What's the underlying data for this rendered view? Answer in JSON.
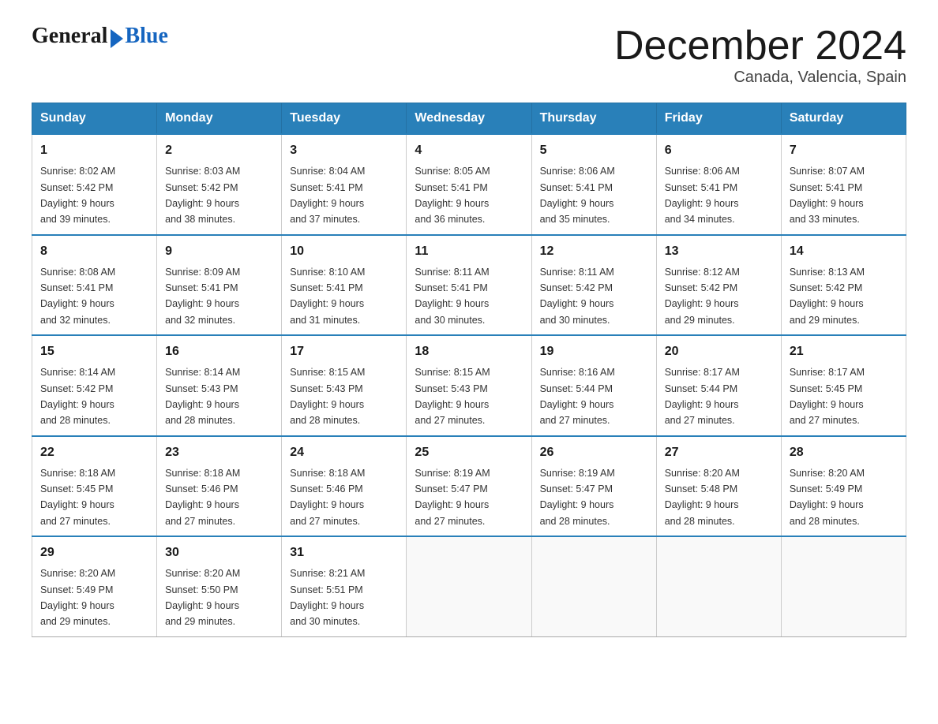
{
  "logo": {
    "text_general": "General",
    "text_blue": "Blue",
    "arrow": true
  },
  "title": "December 2024",
  "subtitle": "Canada, Valencia, Spain",
  "days_of_week": [
    "Sunday",
    "Monday",
    "Tuesday",
    "Wednesday",
    "Thursday",
    "Friday",
    "Saturday"
  ],
  "weeks": [
    [
      {
        "day": "1",
        "sunrise": "Sunrise: 8:02 AM",
        "sunset": "Sunset: 5:42 PM",
        "daylight": "Daylight: 9 hours",
        "daylight2": "and 39 minutes."
      },
      {
        "day": "2",
        "sunrise": "Sunrise: 8:03 AM",
        "sunset": "Sunset: 5:42 PM",
        "daylight": "Daylight: 9 hours",
        "daylight2": "and 38 minutes."
      },
      {
        "day": "3",
        "sunrise": "Sunrise: 8:04 AM",
        "sunset": "Sunset: 5:41 PM",
        "daylight": "Daylight: 9 hours",
        "daylight2": "and 37 minutes."
      },
      {
        "day": "4",
        "sunrise": "Sunrise: 8:05 AM",
        "sunset": "Sunset: 5:41 PM",
        "daylight": "Daylight: 9 hours",
        "daylight2": "and 36 minutes."
      },
      {
        "day": "5",
        "sunrise": "Sunrise: 8:06 AM",
        "sunset": "Sunset: 5:41 PM",
        "daylight": "Daylight: 9 hours",
        "daylight2": "and 35 minutes."
      },
      {
        "day": "6",
        "sunrise": "Sunrise: 8:06 AM",
        "sunset": "Sunset: 5:41 PM",
        "daylight": "Daylight: 9 hours",
        "daylight2": "and 34 minutes."
      },
      {
        "day": "7",
        "sunrise": "Sunrise: 8:07 AM",
        "sunset": "Sunset: 5:41 PM",
        "daylight": "Daylight: 9 hours",
        "daylight2": "and 33 minutes."
      }
    ],
    [
      {
        "day": "8",
        "sunrise": "Sunrise: 8:08 AM",
        "sunset": "Sunset: 5:41 PM",
        "daylight": "Daylight: 9 hours",
        "daylight2": "and 32 minutes."
      },
      {
        "day": "9",
        "sunrise": "Sunrise: 8:09 AM",
        "sunset": "Sunset: 5:41 PM",
        "daylight": "Daylight: 9 hours",
        "daylight2": "and 32 minutes."
      },
      {
        "day": "10",
        "sunrise": "Sunrise: 8:10 AM",
        "sunset": "Sunset: 5:41 PM",
        "daylight": "Daylight: 9 hours",
        "daylight2": "and 31 minutes."
      },
      {
        "day": "11",
        "sunrise": "Sunrise: 8:11 AM",
        "sunset": "Sunset: 5:41 PM",
        "daylight": "Daylight: 9 hours",
        "daylight2": "and 30 minutes."
      },
      {
        "day": "12",
        "sunrise": "Sunrise: 8:11 AM",
        "sunset": "Sunset: 5:42 PM",
        "daylight": "Daylight: 9 hours",
        "daylight2": "and 30 minutes."
      },
      {
        "day": "13",
        "sunrise": "Sunrise: 8:12 AM",
        "sunset": "Sunset: 5:42 PM",
        "daylight": "Daylight: 9 hours",
        "daylight2": "and 29 minutes."
      },
      {
        "day": "14",
        "sunrise": "Sunrise: 8:13 AM",
        "sunset": "Sunset: 5:42 PM",
        "daylight": "Daylight: 9 hours",
        "daylight2": "and 29 minutes."
      }
    ],
    [
      {
        "day": "15",
        "sunrise": "Sunrise: 8:14 AM",
        "sunset": "Sunset: 5:42 PM",
        "daylight": "Daylight: 9 hours",
        "daylight2": "and 28 minutes."
      },
      {
        "day": "16",
        "sunrise": "Sunrise: 8:14 AM",
        "sunset": "Sunset: 5:43 PM",
        "daylight": "Daylight: 9 hours",
        "daylight2": "and 28 minutes."
      },
      {
        "day": "17",
        "sunrise": "Sunrise: 8:15 AM",
        "sunset": "Sunset: 5:43 PM",
        "daylight": "Daylight: 9 hours",
        "daylight2": "and 28 minutes."
      },
      {
        "day": "18",
        "sunrise": "Sunrise: 8:15 AM",
        "sunset": "Sunset: 5:43 PM",
        "daylight": "Daylight: 9 hours",
        "daylight2": "and 27 minutes."
      },
      {
        "day": "19",
        "sunrise": "Sunrise: 8:16 AM",
        "sunset": "Sunset: 5:44 PM",
        "daylight": "Daylight: 9 hours",
        "daylight2": "and 27 minutes."
      },
      {
        "day": "20",
        "sunrise": "Sunrise: 8:17 AM",
        "sunset": "Sunset: 5:44 PM",
        "daylight": "Daylight: 9 hours",
        "daylight2": "and 27 minutes."
      },
      {
        "day": "21",
        "sunrise": "Sunrise: 8:17 AM",
        "sunset": "Sunset: 5:45 PM",
        "daylight": "Daylight: 9 hours",
        "daylight2": "and 27 minutes."
      }
    ],
    [
      {
        "day": "22",
        "sunrise": "Sunrise: 8:18 AM",
        "sunset": "Sunset: 5:45 PM",
        "daylight": "Daylight: 9 hours",
        "daylight2": "and 27 minutes."
      },
      {
        "day": "23",
        "sunrise": "Sunrise: 8:18 AM",
        "sunset": "Sunset: 5:46 PM",
        "daylight": "Daylight: 9 hours",
        "daylight2": "and 27 minutes."
      },
      {
        "day": "24",
        "sunrise": "Sunrise: 8:18 AM",
        "sunset": "Sunset: 5:46 PM",
        "daylight": "Daylight: 9 hours",
        "daylight2": "and 27 minutes."
      },
      {
        "day": "25",
        "sunrise": "Sunrise: 8:19 AM",
        "sunset": "Sunset: 5:47 PM",
        "daylight": "Daylight: 9 hours",
        "daylight2": "and 27 minutes."
      },
      {
        "day": "26",
        "sunrise": "Sunrise: 8:19 AM",
        "sunset": "Sunset: 5:47 PM",
        "daylight": "Daylight: 9 hours",
        "daylight2": "and 28 minutes."
      },
      {
        "day": "27",
        "sunrise": "Sunrise: 8:20 AM",
        "sunset": "Sunset: 5:48 PM",
        "daylight": "Daylight: 9 hours",
        "daylight2": "and 28 minutes."
      },
      {
        "day": "28",
        "sunrise": "Sunrise: 8:20 AM",
        "sunset": "Sunset: 5:49 PM",
        "daylight": "Daylight: 9 hours",
        "daylight2": "and 28 minutes."
      }
    ],
    [
      {
        "day": "29",
        "sunrise": "Sunrise: 8:20 AM",
        "sunset": "Sunset: 5:49 PM",
        "daylight": "Daylight: 9 hours",
        "daylight2": "and 29 minutes."
      },
      {
        "day": "30",
        "sunrise": "Sunrise: 8:20 AM",
        "sunset": "Sunset: 5:50 PM",
        "daylight": "Daylight: 9 hours",
        "daylight2": "and 29 minutes."
      },
      {
        "day": "31",
        "sunrise": "Sunrise: 8:21 AM",
        "sunset": "Sunset: 5:51 PM",
        "daylight": "Daylight: 9 hours",
        "daylight2": "and 30 minutes."
      },
      null,
      null,
      null,
      null
    ]
  ]
}
